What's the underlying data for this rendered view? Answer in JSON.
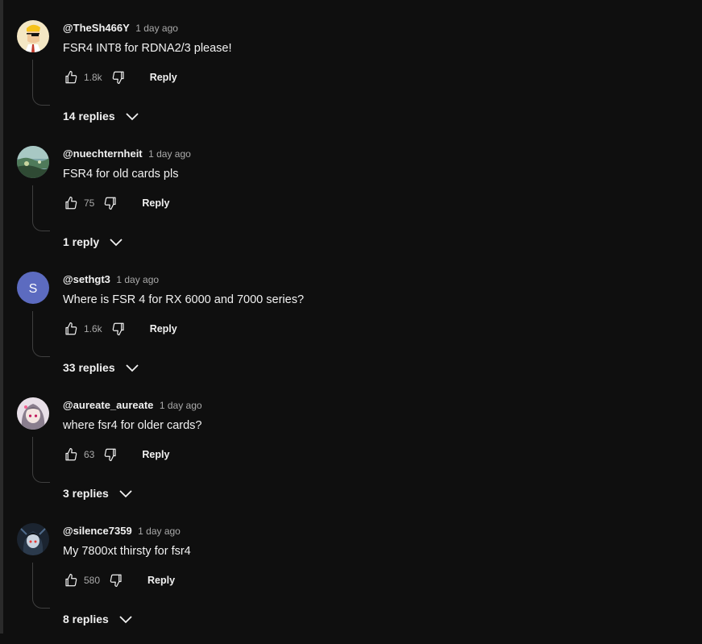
{
  "reply_label": "Reply",
  "comments": [
    {
      "author": "@TheSh466Y",
      "time": "1 day ago",
      "text": "FSR4 INT8 for RDNA2/3 please!",
      "likes": "1.8k",
      "replies": "14 replies",
      "avatar": "cartoon-man-eyepatch"
    },
    {
      "author": "@nuechternheit",
      "time": "1 day ago",
      "text": "FSR4 for old cards pls",
      "likes": "75",
      "replies": "1 reply",
      "avatar": "landscape-photo"
    },
    {
      "author": "@sethgt3",
      "time": "1 day ago",
      "text": "Where is FSR 4 for RX 6000 and 7000 series?",
      "likes": "1.6k",
      "replies": "33 replies",
      "avatar": "letter",
      "avatar_letter": "S",
      "avatar_color": "#5c6bc0"
    },
    {
      "author": "@aureate_aureate",
      "time": "1 day ago",
      "text": "where fsr4 for older cards?",
      "likes": "63",
      "replies": "3 replies",
      "avatar": "anime-girl"
    },
    {
      "author": "@silence7359",
      "time": "1 day ago",
      "text": "My 7800xt thirsty for fsr4",
      "likes": "580",
      "replies": "8 replies",
      "avatar": "dark-character"
    }
  ],
  "colors": {
    "background": "#0f0f0f",
    "text": "#f1f1f1",
    "muted": "#aaaaaa",
    "thread_line": "#3f3f3f"
  }
}
